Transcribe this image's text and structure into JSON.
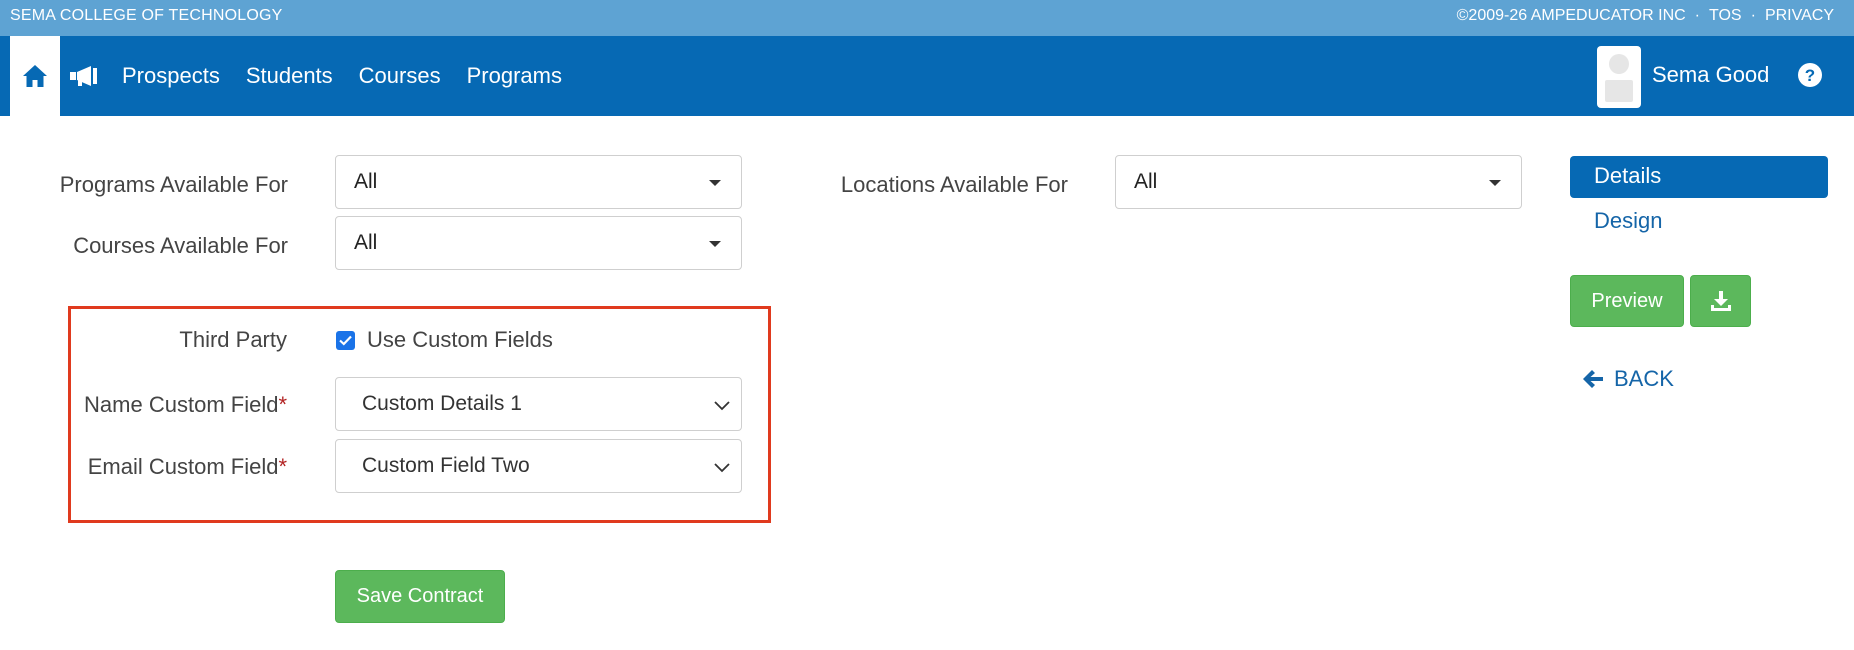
{
  "topbar": {
    "school": "SEMA COLLEGE OF TECHNOLOGY",
    "copyright": "©2009-26 AMPEDUCATOR INC",
    "tos": "TOS",
    "privacy": "PRIVACY",
    "separator": "·"
  },
  "nav": {
    "home_icon": "home-icon",
    "announce_icon": "megaphone-icon",
    "links": [
      "Prospects",
      "Students",
      "Courses",
      "Programs"
    ],
    "user_name": "Sema Good",
    "help_icon": "question-circle-icon"
  },
  "form": {
    "programs_label": "Programs Available For",
    "programs_value": "All",
    "courses_label": "Courses Available For",
    "courses_value": "All",
    "locations_label": "Locations Available For",
    "locations_value": "All",
    "third_party_label": "Third Party",
    "use_custom_label": "Use Custom Fields",
    "use_custom_checked": true,
    "name_field_label": "Name Custom Field",
    "name_field_value": "Custom Details 1",
    "email_field_label": "Email Custom Field",
    "email_field_value": "Custom Field Two",
    "required_mark": "*",
    "save_label": "Save Contract"
  },
  "sidebar": {
    "details": "Details",
    "design": "Design",
    "preview": "Preview",
    "download_icon": "download-icon",
    "back": "BACK",
    "back_icon": "arrow-left-icon"
  },
  "colors": {
    "topbar": "#5ea3d3",
    "navbar": "#0669b4",
    "green": "#5cb85c",
    "highlight_box": "#e03a1e",
    "link": "#1565a8"
  }
}
